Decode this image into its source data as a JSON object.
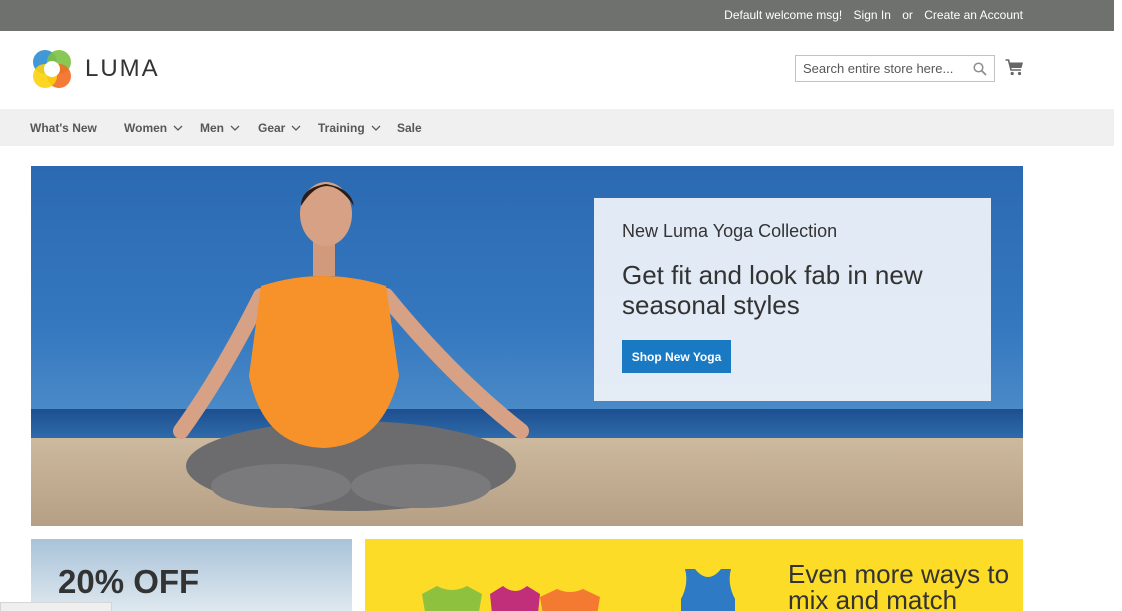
{
  "topbar": {
    "welcome": "Default welcome msg!",
    "sign_in": "Sign In",
    "or": "or",
    "create_account": "Create an Account"
  },
  "header": {
    "logo_text": "LUMA",
    "search_placeholder": "Search entire store here...",
    "icons": [
      "search-icon",
      "cart-icon"
    ]
  },
  "nav": {
    "items": [
      {
        "label": "What's New",
        "has_dropdown": false
      },
      {
        "label": "Women",
        "has_dropdown": true
      },
      {
        "label": "Men",
        "has_dropdown": true
      },
      {
        "label": "Gear",
        "has_dropdown": true
      },
      {
        "label": "Training",
        "has_dropdown": true
      },
      {
        "label": "Sale",
        "has_dropdown": false
      }
    ]
  },
  "hero": {
    "kicker": "New Luma Yoga Collection",
    "headline": "Get fit and look fab in new seasonal styles",
    "button": "Shop New Yoga"
  },
  "promos": {
    "left_title": "20% OFF",
    "right_title": "Even more ways to mix and match"
  },
  "colors": {
    "topbar": "#6e716e",
    "nav_bg": "#f0f0f0",
    "button_blue": "#1979c3",
    "promo_yellow": "#fcdc26"
  }
}
